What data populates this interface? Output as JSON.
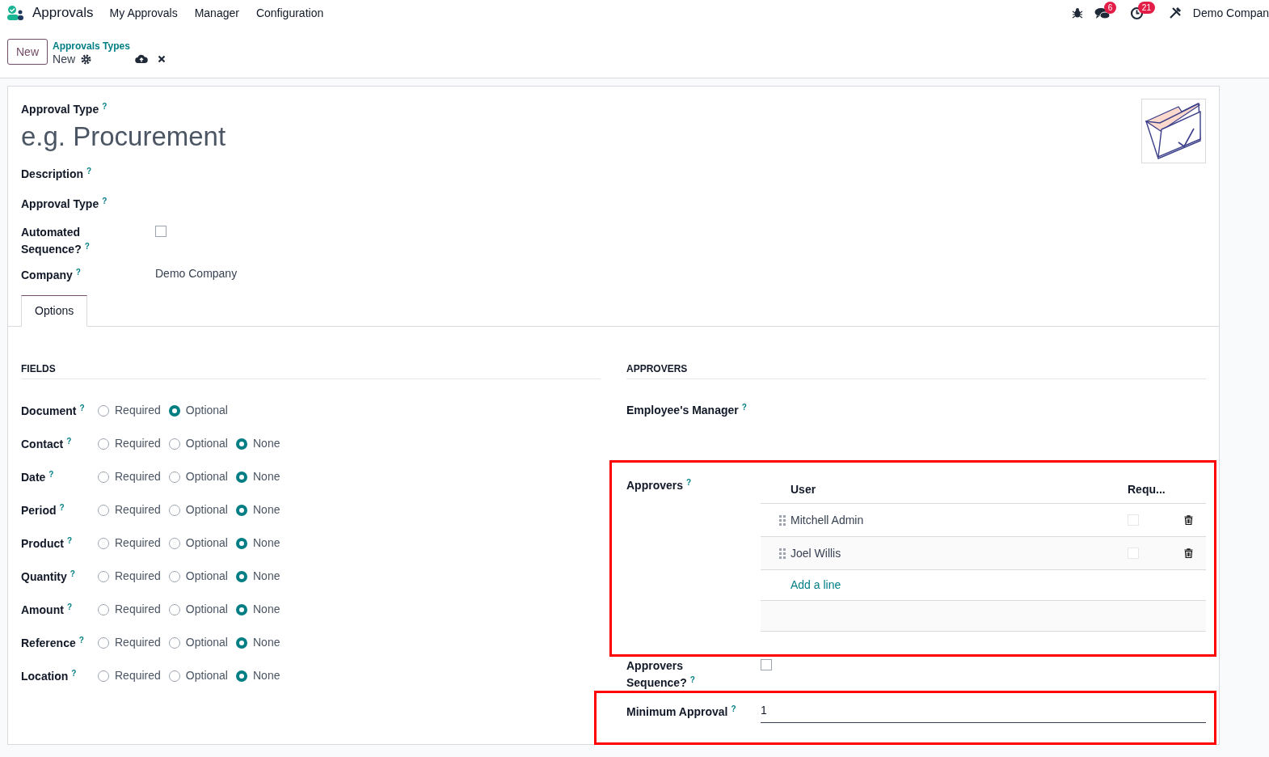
{
  "topbar": {
    "app": "Approvals",
    "menu": [
      "My Approvals",
      "Manager",
      "Configuration"
    ],
    "messages_badge": "6",
    "activities_badge": "21",
    "company": "Demo Compan"
  },
  "control_panel": {
    "new_button": "New",
    "breadcrumb": "Approvals Types",
    "record": "New"
  },
  "form": {
    "title_label": "Approval Type",
    "help": "?",
    "name_placeholder": "e.g. Procurement",
    "fields": [
      {
        "label": "Description",
        "kind": "text"
      },
      {
        "label": "Approval Type",
        "kind": "text"
      },
      {
        "label": "Automated Sequence?",
        "kind": "checkbox",
        "checked": false
      },
      {
        "label": "Company",
        "kind": "text",
        "value": "Demo Company"
      }
    ],
    "tabs": [
      {
        "label": "Options",
        "selected": true
      }
    ],
    "fields_section": {
      "title": "FIELDS",
      "rows": [
        {
          "label": "Document",
          "options": [
            {
              "label": "Required",
              "selected": false
            },
            {
              "label": "Optional",
              "selected": true
            }
          ]
        },
        {
          "label": "Contact",
          "options": [
            {
              "label": "Required",
              "selected": false
            },
            {
              "label": "Optional",
              "selected": false
            },
            {
              "label": "None",
              "selected": true
            }
          ]
        },
        {
          "label": "Date",
          "options": [
            {
              "label": "Required",
              "selected": false
            },
            {
              "label": "Optional",
              "selected": false
            },
            {
              "label": "None",
              "selected": true
            }
          ]
        },
        {
          "label": "Period",
          "options": [
            {
              "label": "Required",
              "selected": false
            },
            {
              "label": "Optional",
              "selected": false
            },
            {
              "label": "None",
              "selected": true
            }
          ]
        },
        {
          "label": "Product",
          "options": [
            {
              "label": "Required",
              "selected": false
            },
            {
              "label": "Optional",
              "selected": false
            },
            {
              "label": "None",
              "selected": true
            }
          ]
        },
        {
          "label": "Quantity",
          "options": [
            {
              "label": "Required",
              "selected": false
            },
            {
              "label": "Optional",
              "selected": false
            },
            {
              "label": "None",
              "selected": true
            }
          ]
        },
        {
          "label": "Amount",
          "options": [
            {
              "label": "Required",
              "selected": false
            },
            {
              "label": "Optional",
              "selected": false
            },
            {
              "label": "None",
              "selected": true
            }
          ]
        },
        {
          "label": "Reference",
          "options": [
            {
              "label": "Required",
              "selected": false
            },
            {
              "label": "Optional",
              "selected": false
            },
            {
              "label": "None",
              "selected": true
            }
          ]
        },
        {
          "label": "Location",
          "options": [
            {
              "label": "Required",
              "selected": false
            },
            {
              "label": "Optional",
              "selected": false
            },
            {
              "label": "None",
              "selected": true
            }
          ]
        }
      ]
    },
    "approvers_section": {
      "title": "APPROVERS",
      "manager_label": "Employee's Manager",
      "approvers_label": "Approvers",
      "table": {
        "columns": [
          "User",
          "Requ..."
        ],
        "rows": [
          {
            "user": "Mitchell Admin",
            "required": false
          },
          {
            "user": "Joel Willis",
            "required": false
          }
        ],
        "add_line": "Add a line"
      },
      "sequence_label": "Approvers Sequence?",
      "sequence_checked": false,
      "minimum_label": "Minimum Approval",
      "minimum_value": "1"
    }
  }
}
